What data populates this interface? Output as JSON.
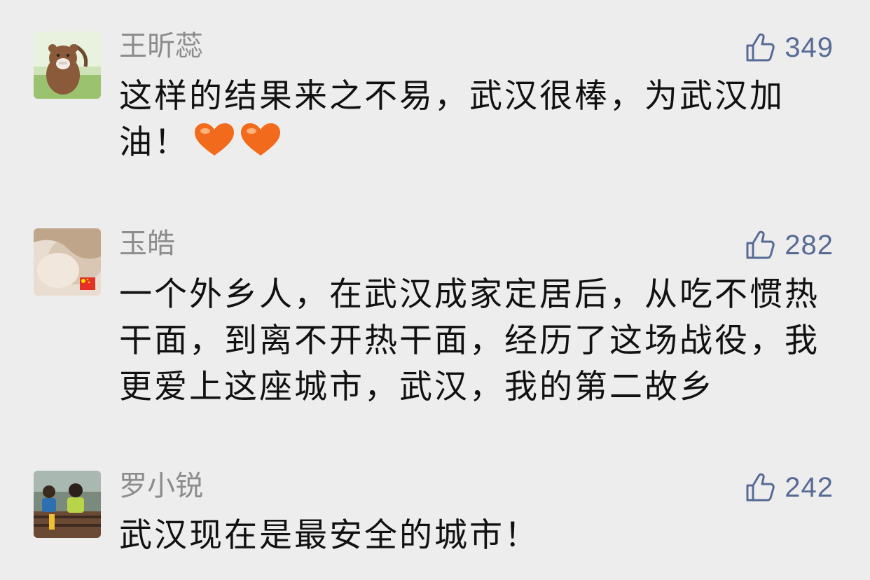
{
  "accent_color": "#576b95",
  "comments": [
    {
      "user": "王昕蕊",
      "likes": "349",
      "text": "这样的结果来之不易，武汉很棒，为武汉加油！",
      "emoji": [
        "heart-emoji",
        "heart-emoji"
      ]
    },
    {
      "user": "玉皓",
      "likes": "282",
      "text": "一个外乡人，在武汉成家定居后，从吃不惯热干面，到离不开热干面，经历了这场战役，我更爱上这座城市，武汉，我的第二故乡"
    },
    {
      "user": "罗小锐",
      "likes": "242",
      "text": "武汉现在是最安全的城市！"
    }
  ]
}
